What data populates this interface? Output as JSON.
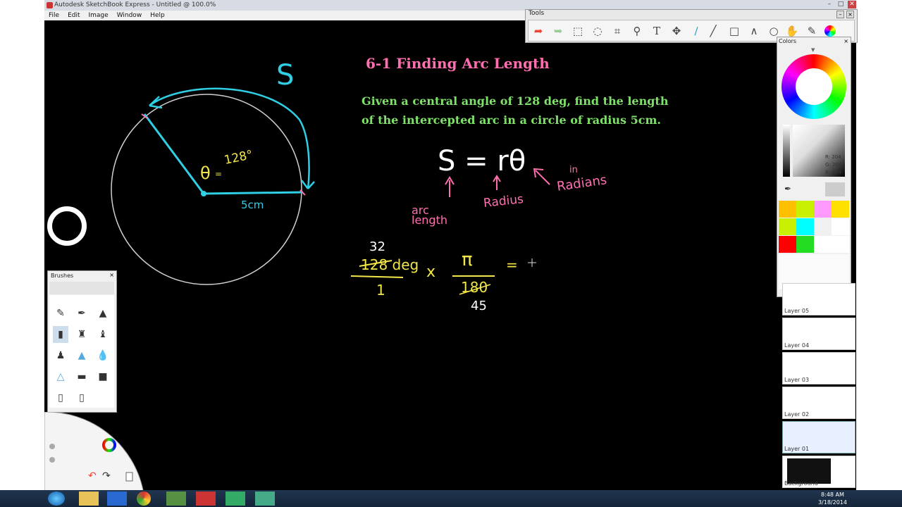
{
  "window": {
    "title": "Autodesk SketchBook Express - Untitled @ 100.0%",
    "menu": [
      "File",
      "Edit",
      "Image",
      "Window",
      "Help"
    ],
    "controls": [
      "–",
      "□",
      "✕"
    ]
  },
  "tools_panel": {
    "title": "Tools",
    "buttons": [
      "undo",
      "redo",
      "select",
      "lasso",
      "crop",
      "zoom",
      "text",
      "move",
      "pen",
      "line",
      "rectangle",
      "polyline",
      "ellipse",
      "hand",
      "brush",
      "color-wheel"
    ]
  },
  "colors_panel": {
    "title": "Colors",
    "rgb": {
      "r_label": "R:",
      "r": "204",
      "g_label": "G:",
      "g": "204",
      "b_label": "B:",
      "b": "204"
    },
    "swatches": [
      "#ffc000",
      "#c9f000",
      "#ff99ff",
      "#ffe000",
      "#c9f000",
      "#00ffff",
      "#f0f0f0",
      "#ffffff",
      "#ff0000",
      "#22dd22",
      "#ffffff",
      "#ffffff"
    ]
  },
  "layers": [
    "Layer 05",
    "Layer 04",
    "Layer 03",
    "Layer 02",
    "Layer 01",
    "Background"
  ],
  "brushes_panel": {
    "title": "Brushes"
  },
  "canvas": {
    "heading": "6-1 Finding Arc Length",
    "problem": "Given a central angle of 128 deg, find the length of the intercepted arc in a circle of radius 5cm.",
    "labels": {
      "s": "S",
      "theta": "θ",
      "eq": "=",
      "angle": "128°",
      "radius": "5cm",
      "formula": "S = rθ",
      "arc_length": "arc length",
      "radius_word": "Radius",
      "in": "in",
      "radians": "Radians",
      "num_reduced": "32",
      "num": "128 deg",
      "den": "1",
      "times": "x",
      "pi": "π",
      "den2": "180",
      "den2_reduced": "45",
      "equals": "="
    }
  },
  "taskbar": {
    "time": "8:48 AM",
    "date": "3/18/2014"
  },
  "colors": {
    "cyan": "#2fd0e6",
    "yellow": "#f2e64a",
    "pink": "#ff6fb0",
    "green": "#7fe06a",
    "white_circle": "#cfcfcf"
  }
}
